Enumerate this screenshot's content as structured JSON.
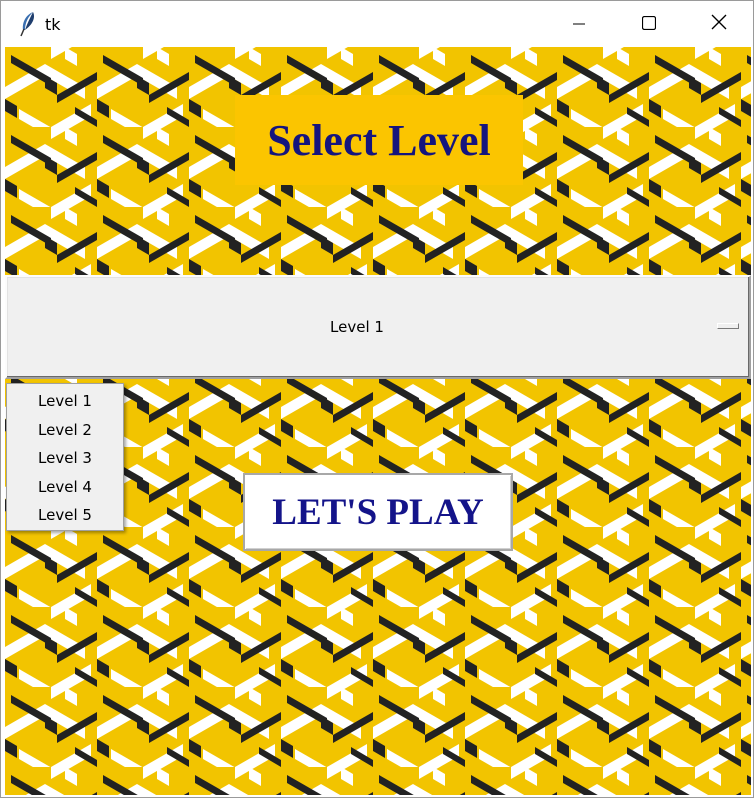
{
  "window": {
    "title": "tk",
    "app_icon": "tk-feather-icon",
    "controls": [
      "minimize-icon",
      "maximize-icon",
      "close-icon"
    ]
  },
  "colors": {
    "background_yellow": "#f2c400",
    "stripe_dark": "#222222",
    "stripe_light": "#ffffff",
    "heading_bg": "#fbc500",
    "heading_text": "#15157e",
    "button_text": "#14148a",
    "menu_bg": "#f0f0f0"
  },
  "heading": {
    "text": "Select Level"
  },
  "level_select": {
    "selected": "Level 1",
    "indicator_icon": "option-menu-indicator-icon",
    "options": [
      "Level 1",
      "Level 2",
      "Level 3",
      "Level 4",
      "Level 5"
    ]
  },
  "play_button": {
    "label": "LET'S PLAY"
  }
}
